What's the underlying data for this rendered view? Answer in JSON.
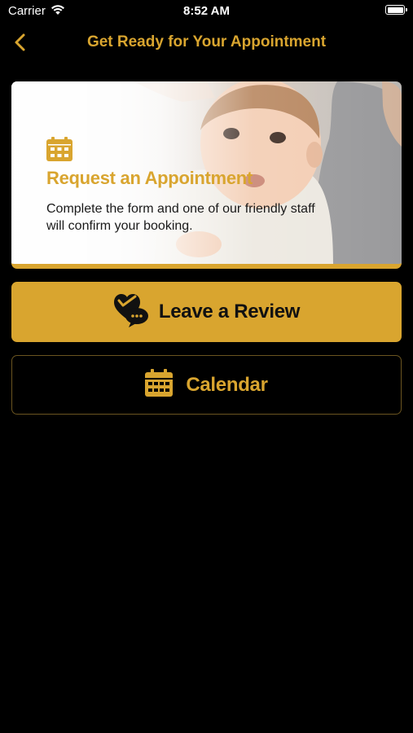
{
  "status_bar": {
    "carrier": "Carrier",
    "time": "8:52 AM",
    "wifi_icon": "wifi-icon",
    "battery_icon": "battery-icon"
  },
  "nav": {
    "title": "Get Ready for Your Appointment",
    "back_icon": "chevron-left-icon"
  },
  "hero": {
    "icon": "calendar-icon",
    "heading": "Request an Appointment",
    "description": "Complete the form and one of our friendly staff will confirm your booking."
  },
  "actions": {
    "review": {
      "label": "Leave a Review",
      "icon": "heart-chat-icon"
    },
    "calendar": {
      "label": "Calendar",
      "icon": "calendar-icon"
    }
  },
  "colors": {
    "background": "#000000",
    "accent": "#d9a52f",
    "dark_text": "#111111"
  }
}
